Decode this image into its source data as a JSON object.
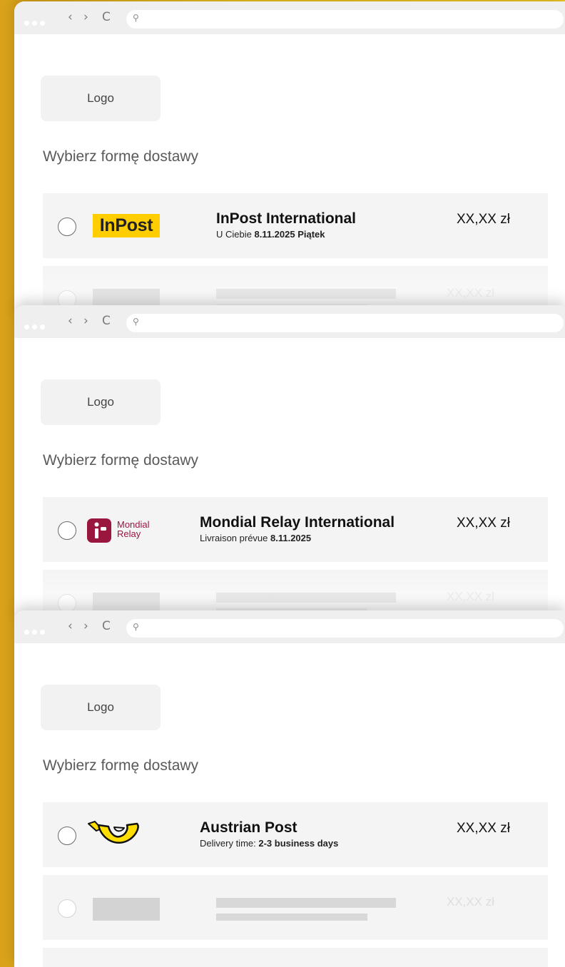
{
  "browser": {
    "nav_back": "‹",
    "nav_forward": "›",
    "nav_reload": "C",
    "search_glyph": "⚲"
  },
  "windows": [
    {
      "logo_label": "Logo",
      "section_title": "Wybierz formę dostawy",
      "option": {
        "carrier": "InPost",
        "logo_text": "InPost",
        "name": "InPost International",
        "sub_prefix": "U Ciebie ",
        "sub_bold": "8.11.2025 Piątek",
        "price": "XX,XX zł"
      },
      "placeholder_price": "XX,XX zł"
    },
    {
      "logo_label": "Logo",
      "section_title": "Wybierz formę dostawy",
      "option": {
        "carrier": "Mondial Relay",
        "logo_line1": "Mondial",
        "logo_line2": "Relay",
        "name": "Mondial Relay International",
        "sub_prefix": "Livraison prévue ",
        "sub_bold": "8.11.2025",
        "price": "XX,XX zł"
      },
      "placeholder_price": "XX,XX zł"
    },
    {
      "logo_label": "Logo",
      "section_title": "Wybierz formę dostawy",
      "option": {
        "carrier": "Austrian Post",
        "name": "Austrian Post",
        "sub_prefix": "Delivery time: ",
        "sub_bold": "2-3 business days",
        "price": "XX,XX zł"
      },
      "placeholder_price": "XX,XX zł"
    }
  ],
  "colors": {
    "background_yellow": "#f2c21c",
    "inpost_yellow": "#ffcd00",
    "mondial_relay_red": "#99163f",
    "austrian_post_yellow": "#ffde00"
  }
}
